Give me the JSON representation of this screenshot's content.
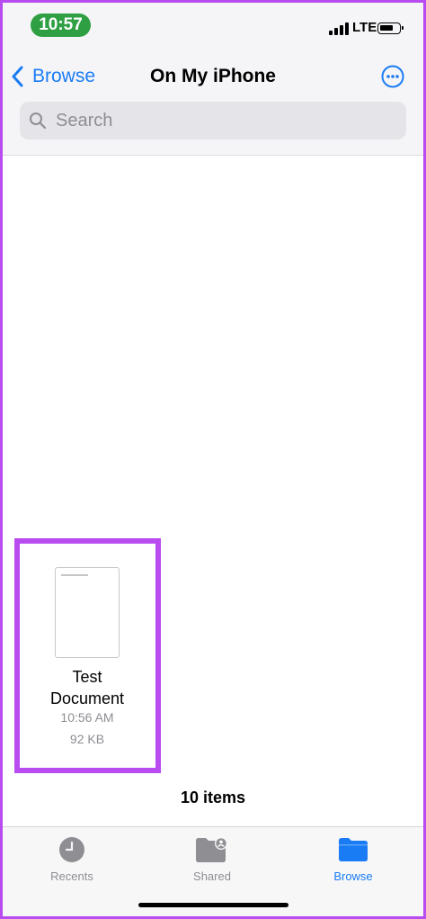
{
  "status_bar": {
    "time": "10:57",
    "network": "LTE",
    "time_pill_color": "#2ea043"
  },
  "nav": {
    "back_label": "Browse",
    "title": "On My iPhone",
    "more_icon": "ellipsis-circle-icon"
  },
  "search": {
    "placeholder": "Search",
    "value": ""
  },
  "file": {
    "name_line1": "Test",
    "name_line2": "Document",
    "time": "10:56 AM",
    "size": "92 KB"
  },
  "item_count": "10 items",
  "tab_bar": {
    "tabs": [
      {
        "label": "Recents",
        "icon": "clock-icon",
        "active": false
      },
      {
        "label": "Shared",
        "icon": "shared-folder-icon",
        "active": false
      },
      {
        "label": "Browse",
        "icon": "folder-icon",
        "active": true
      }
    ]
  },
  "colors": {
    "accent": "#1a7cf5",
    "highlight": "#b84cf0",
    "secondary_text": "#8e8e93"
  }
}
